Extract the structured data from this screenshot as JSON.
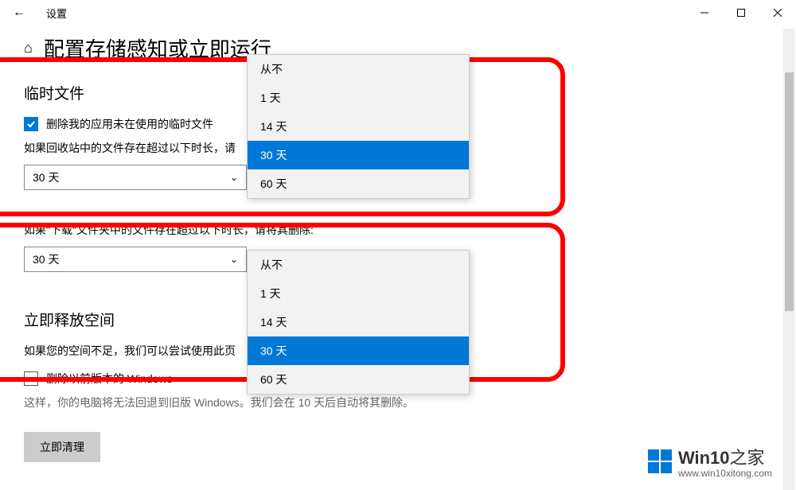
{
  "titlebar": {
    "title": "设置"
  },
  "page": {
    "title": "配置存储感知或立即运行"
  },
  "temp_files": {
    "heading": "临时文件",
    "checkbox_label": "删除我的应用未在使用的临时文件",
    "recycle_desc": "如果回收站中的文件存在超过以下时长，请",
    "recycle_selected": "30 天"
  },
  "downloads": {
    "desc": "如果\"下载\"文件夹中的文件存在超过以下时长，请将其删除:",
    "selected": "30 天"
  },
  "free_space": {
    "heading": "立即释放空间",
    "desc_partial": "如果您的空间不足，我们可以尝试使用此页",
    "old_windows_label": "删除以前版本的 Windows",
    "old_windows_desc": "这样，你的电脑将无法回退到旧版 Windows。我们会在 10 天后自动将其删除。",
    "button": "立即清理"
  },
  "options": [
    "从不",
    "1 天",
    "14 天",
    "30 天",
    "60 天"
  ],
  "watermark": {
    "brand": "Win10",
    "suffix": "之家",
    "url": "www.win10xitong.com"
  }
}
